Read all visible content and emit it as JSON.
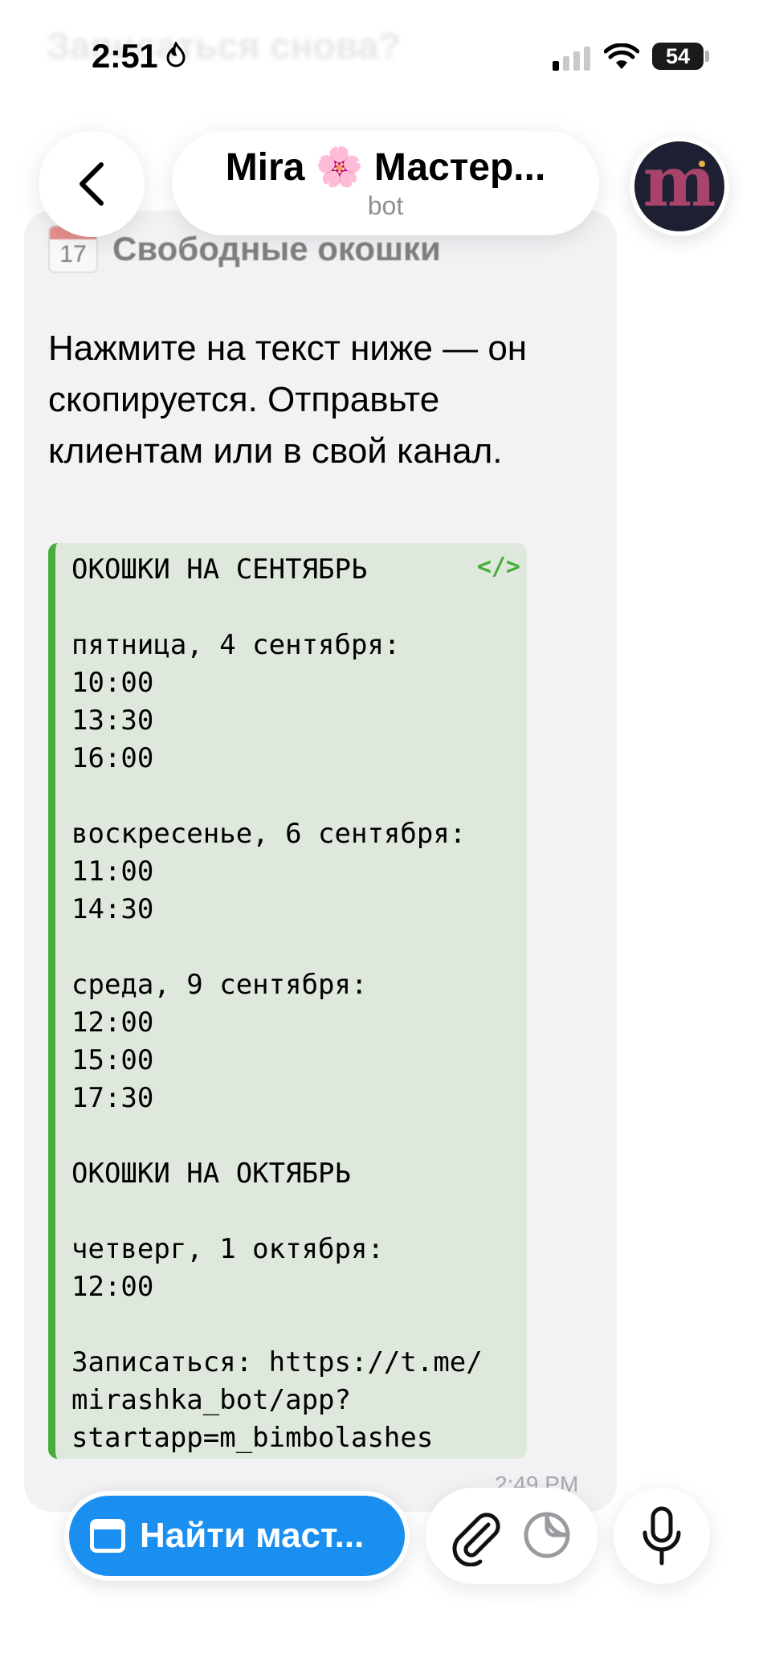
{
  "status_bar": {
    "time": "2:51",
    "battery": "54"
  },
  "background_ghost": "Записаться снова?",
  "header": {
    "title": "Mira 🌸 Мастер...",
    "subtitle": "bot",
    "avatar_letter": "m"
  },
  "message": {
    "calendar_day": "17",
    "heading": "Свободные окошки",
    "intro": "Нажмите на текст ниже — он скопируется. Отправьте клиентам или в свой канал.",
    "code_icon": "</>",
    "code_lines": [
      "ОКОШКИ НА СЕНТЯБРЬ",
      "",
      "пятница, 4 сентября:",
      "10:00",
      "13:30",
      "16:00",
      "",
      "воскресенье, 6 сентября:",
      "11:00",
      "14:30",
      "",
      "среда, 9 сентября:",
      "12:00",
      "15:00",
      "17:30",
      "",
      "ОКОШКИ НА ОКТЯБРЬ",
      "",
      "четверг, 1 октября:",
      "12:00",
      "",
      "Записаться: https://t.me/",
      "mirashka_bot/app?",
      "startapp=m_bimbolashes"
    ],
    "time": "2:49 PM"
  },
  "input_bar": {
    "app_button_label": "Найти маст...",
    "icons": [
      "paperclip-icon",
      "sticker-icon",
      "microphone-icon"
    ]
  },
  "colors": {
    "accent_blue": "#1a8ff0",
    "code_green": "#46ad39",
    "code_bg": "#dfe8dc",
    "bubble_bg": "#f2f2f5"
  }
}
